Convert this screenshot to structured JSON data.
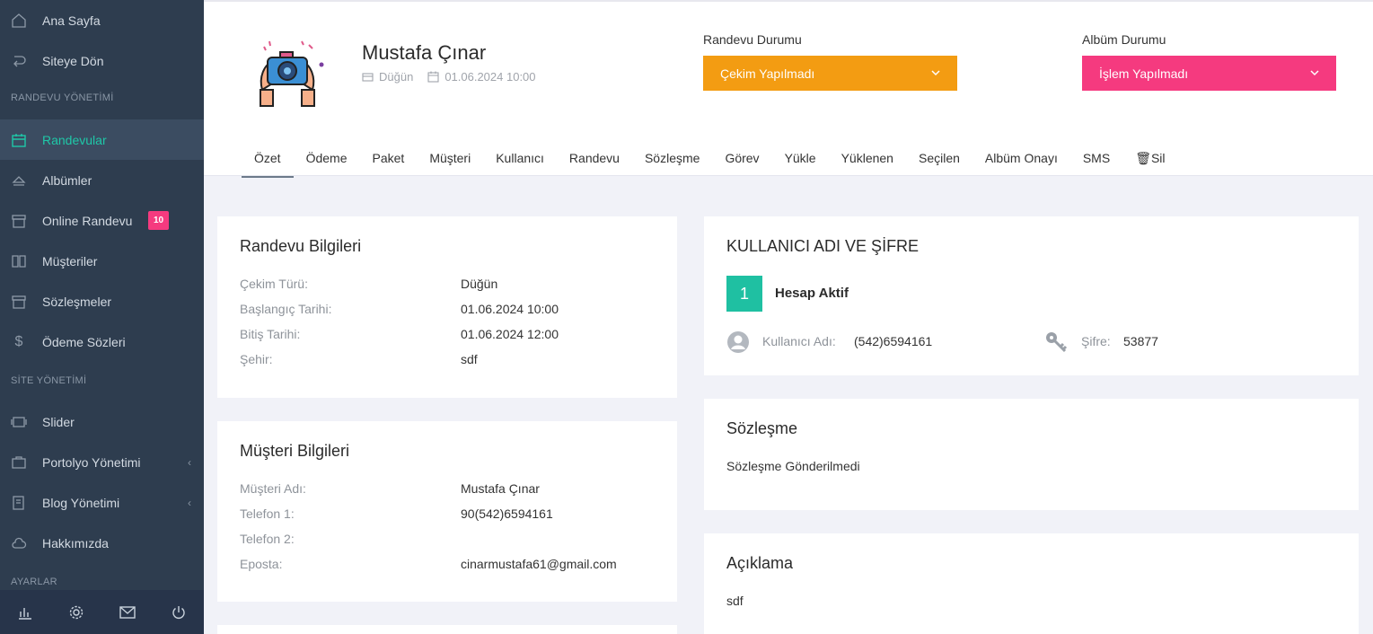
{
  "sidebar": {
    "items": [
      {
        "label": "Ana Sayfa",
        "icon": "home-icon"
      },
      {
        "label": "Siteye Dön",
        "icon": "return-icon"
      },
      {
        "label": "Randevular",
        "icon": "calendar-icon",
        "active": true
      },
      {
        "label": "Albümler",
        "icon": "eject-icon"
      },
      {
        "label": "Online Randevu",
        "icon": "archive-icon",
        "badge": "10"
      },
      {
        "label": "Müşteriler",
        "icon": "book-icon"
      },
      {
        "label": "Sözleşmeler",
        "icon": "archive-icon"
      },
      {
        "label": "Ödeme Sözleri",
        "icon": "dollar-icon"
      },
      {
        "label": "Slider",
        "icon": "slider-icon"
      },
      {
        "label": "Portolyo Yönetimi",
        "icon": "portfolio-icon"
      },
      {
        "label": "Blog Yönetimi",
        "icon": "blog-icon"
      },
      {
        "label": "Hakkımızda",
        "icon": "cloud-icon"
      }
    ],
    "sections": {
      "randevu": "RANDEVU YÖNETİMİ",
      "site": "SİTE YÖNETİMİ",
      "ayarlar": "AYARLAR"
    },
    "chevron": "‹"
  },
  "header": {
    "name": "Mustafa Çınar",
    "type": "Düğün",
    "datetime": "01.06.2024 10:00",
    "randevu_label": "Randevu Durumu",
    "randevu_value": "Çekim Yapılmadı",
    "randevu_color": "#f39c12",
    "album_label": "Albüm Durumu",
    "album_value": "İşlem Yapılmadı",
    "album_color": "#f53a7f"
  },
  "tabs": [
    "Özet",
    "Ödeme",
    "Paket",
    "Müşteri",
    "Kullanıcı",
    "Randevu",
    "Sözleşme",
    "Görev",
    "Yükle",
    "Yüklenen",
    "Seçilen",
    "Albüm Onayı",
    "SMS",
    "🗑Sil"
  ],
  "randevu_card": {
    "title": "Randevu Bilgileri",
    "rows": [
      {
        "k": "Çekim Türü:",
        "v": "Düğün"
      },
      {
        "k": "Başlangıç Tarihi:",
        "v": "01.06.2024 10:00"
      },
      {
        "k": "Bitiş Tarihi:",
        "v": "01.06.2024 12:00"
      },
      {
        "k": "Şehir:",
        "v": "sdf"
      }
    ]
  },
  "musteri_card": {
    "title": "Müşteri Bilgileri",
    "rows": [
      {
        "k": "Müşteri Adı:",
        "v": "Mustafa Çınar"
      },
      {
        "k": "Telefon 1:",
        "v": "90(542)6594161"
      },
      {
        "k": "Telefon 2:",
        "v": ""
      },
      {
        "k": "Eposta:",
        "v": "cinarmustafa61@gmail.com"
      }
    ]
  },
  "account_card": {
    "title": "KULLANICI ADI VE ŞİFRE",
    "count": "1",
    "status": "Hesap Aktif",
    "user_label": "Kullanıcı Adı:",
    "user_value": "(542)6594161",
    "pass_label": "Şifre:",
    "pass_value": "53877"
  },
  "contract_card": {
    "title": "Sözleşme",
    "text": "Sözleşme Gönderilmedi"
  },
  "desc_card": {
    "title": "Açıklama",
    "text": "sdf"
  }
}
